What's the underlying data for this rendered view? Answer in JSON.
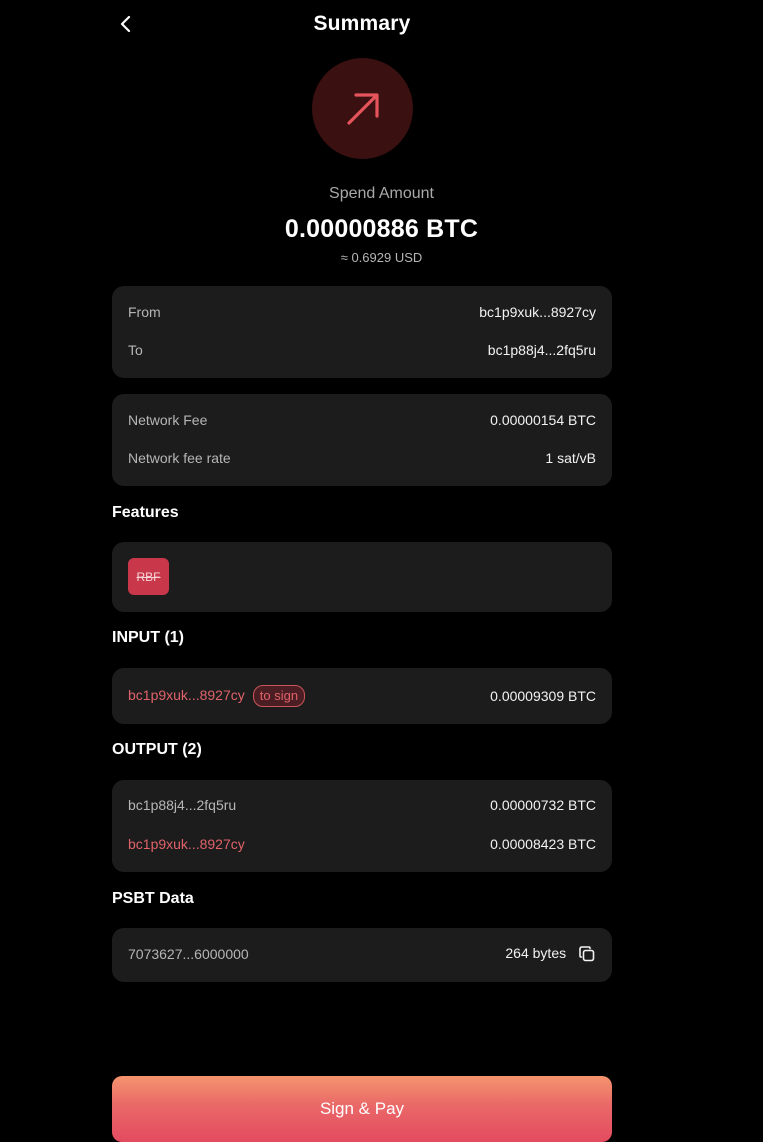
{
  "header": {
    "title": "Summary"
  },
  "summary": {
    "spend_label": "Spend Amount",
    "amount": "0.00000886 BTC",
    "usd": "≈ 0.6929 USD"
  },
  "addresses": {
    "from_label": "From",
    "from_value": "bc1p9xuk...8927cy",
    "to_label": "To",
    "to_value": "bc1p88j4...2fq5ru"
  },
  "fees": {
    "fee_label": "Network Fee",
    "fee_value": "0.00000154 BTC",
    "rate_label": "Network fee rate",
    "rate_value": "1 sat/vB"
  },
  "features": {
    "title": "Features",
    "badge": "RBF"
  },
  "inputs": {
    "title": "INPUT (1)",
    "items": [
      {
        "address": "bc1p9xuk...8927cy",
        "tag": "to sign",
        "amount": "0.00009309 BTC"
      }
    ]
  },
  "outputs": {
    "title": "OUTPUT (2)",
    "items": [
      {
        "address": "bc1p88j4...2fq5ru",
        "amount": "0.00000732 BTC"
      },
      {
        "address": "bc1p9xuk...8927cy",
        "amount": "0.00008423 BTC"
      }
    ]
  },
  "psbt": {
    "title": "PSBT Data",
    "data": "7073627...6000000",
    "size": "264 bytes"
  },
  "actions": {
    "sign_label": "Sign & Pay"
  },
  "colors": {
    "accent": "#e34b60",
    "accent_light": "#f4946e",
    "card": "#1c1c1c",
    "background": "#000000",
    "own_address": "#e0626a"
  },
  "icons": {
    "back": "chevron-left-icon",
    "send": "arrow-up-right-icon",
    "copy": "copy-icon"
  }
}
